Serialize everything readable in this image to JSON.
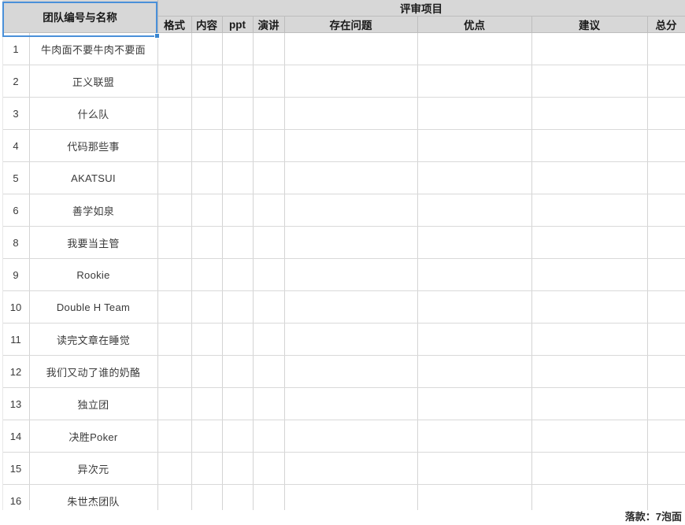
{
  "sheet": {
    "header": {
      "name_column": "团队编号与名称",
      "group_title": "评审项目",
      "sub_columns": [
        "格式",
        "内容",
        "ppt",
        "演讲",
        "存在问题",
        "优点",
        "建议",
        "总分"
      ]
    },
    "rows": [
      {
        "num": "1",
        "name": "牛肉面不要牛肉不要面"
      },
      {
        "num": "2",
        "name": "正义联盟"
      },
      {
        "num": "3",
        "name": "什么队"
      },
      {
        "num": "4",
        "name": "代码那些事"
      },
      {
        "num": "5",
        "name": "AKATSUI"
      },
      {
        "num": "6",
        "name": "善学如泉"
      },
      {
        "num": "8",
        "name": "我要当主管"
      },
      {
        "num": "9",
        "name": "Rookie"
      },
      {
        "num": "10",
        "name": "Double H Team"
      },
      {
        "num": "11",
        "name": "读完文章在睡觉"
      },
      {
        "num": "12",
        "name": "我们又动了谁的奶酪"
      },
      {
        "num": "13",
        "name": "独立团"
      },
      {
        "num": "14",
        "name": "决胜Poker"
      },
      {
        "num": "15",
        "name": "异次元"
      },
      {
        "num": "16",
        "name": "朱世杰团队"
      }
    ],
    "footer_note": "落款：7泡面",
    "colors": {
      "header_bg": "#d7d7d7",
      "grid_line": "#d9d9d9",
      "selection": "#4a90d9",
      "text": "#3a3a3a"
    }
  }
}
